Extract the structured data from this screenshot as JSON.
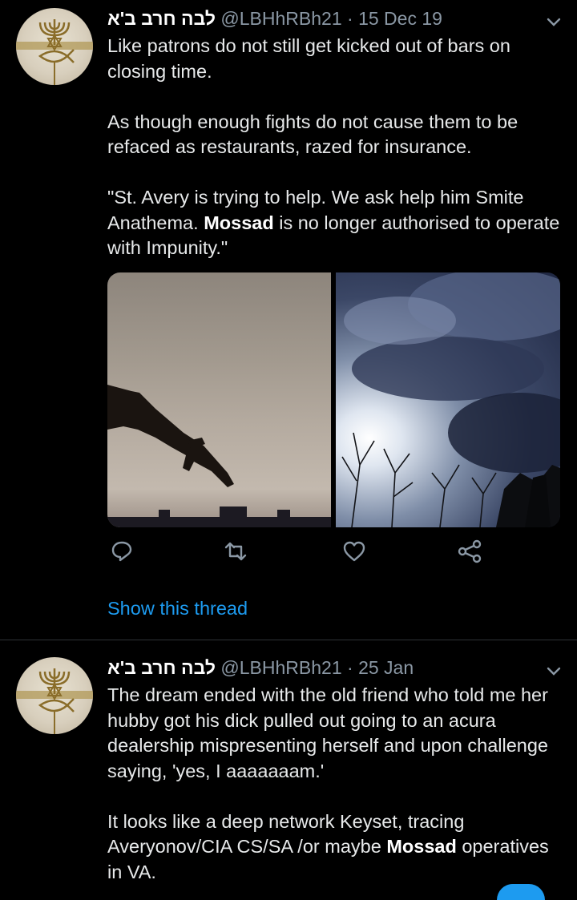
{
  "tweets": [
    {
      "author": {
        "name": "לבה חרב ב'א",
        "handle": "@LBHhRBh21"
      },
      "separator": "·",
      "date": "15 Dec 19",
      "paragraphs": [
        [
          "Like patrons do not still get kicked out of bars on closing time."
        ],
        [
          "As though enough fights do not cause them to be refaced as restaurants, razed for insurance."
        ],
        [
          "\"St. Avery is trying to help. We ask help him Smite Anathema. ",
          "Mossad",
          " is no longer authorised to operate with Impunity.\""
        ]
      ],
      "actions": [
        "reply-icon",
        "retweet-icon",
        "like-icon",
        "share-icon"
      ],
      "show_thread": "Show this thread"
    },
    {
      "author": {
        "name": "לבה חרב ב'א",
        "handle": "@LBHhRBh21"
      },
      "separator": "·",
      "date": "25 Jan",
      "paragraphs": [
        [
          "The dream ended with the old friend who told me her hubby got his dick pulled out going to an acura dealership mispresenting herself and upon challenge saying, 'yes, I aaaaaaam.'"
        ],
        [
          "It looks like a deep network Keyset, tracing Averyonov/CIA CS/SA /or maybe ",
          "Mossad",
          " operatives in VA."
        ]
      ]
    }
  ],
  "colors": {
    "accent": "#1d9bf0",
    "muted": "#8b98a5",
    "background": "#000000"
  }
}
